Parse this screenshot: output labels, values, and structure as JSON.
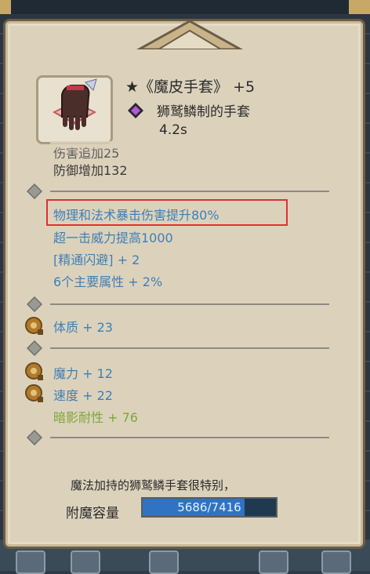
{
  "item": {
    "title": "★《魔皮手套》 +5",
    "subtitle": "狮鹫鳞制的手套",
    "time": "4.2s",
    "icon": "glove-icon",
    "gem_icon": "purple-gem-icon"
  },
  "stats": {
    "cut_line": "伤害追加25",
    "defense": "防御增加132",
    "crit_damage": "物理和法术暴击伤害提升80%",
    "strike_power": "超一击威力提高1000",
    "evasion": "[精通闪避] + 2",
    "main_attrs": "6个主要属性 + 2%",
    "constitution": "体质 + 23",
    "magic": "魔力 + 12",
    "speed": "速度 + 22",
    "shadow_res": "暗影耐性 + 76"
  },
  "description": "魔法加持的狮鹫鳞手套很特别，",
  "enchant": {
    "label": "附魔容量",
    "value_text": "5686/7416",
    "fraction": 0.767
  },
  "colors": {
    "blue_text": "#3f7fb5",
    "green_text": "#7ea53a",
    "highlight": "#e03030",
    "bar_fill": "#2f73c2"
  }
}
